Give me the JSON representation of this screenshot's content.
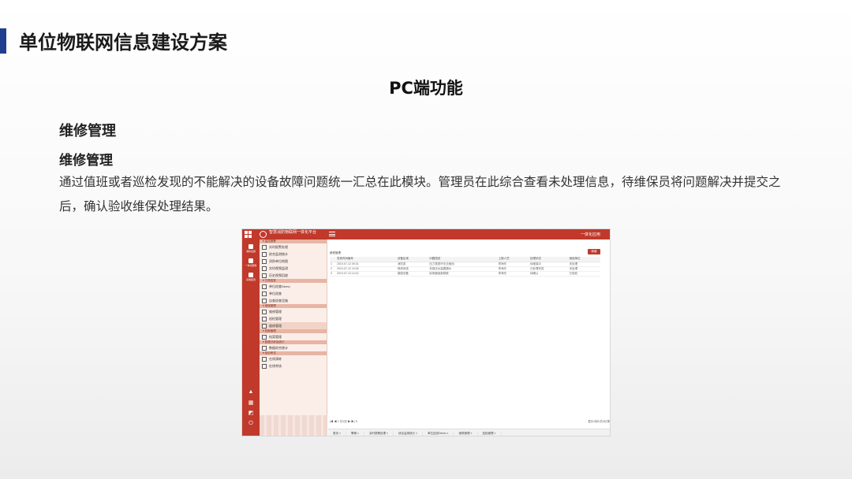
{
  "slide": {
    "title": "单位物联网信息建设方案",
    "subtitle": "PC端功能",
    "section_heading": "维修管理",
    "sub_heading": "维修管理",
    "description": "通过值班或者巡检发现的不能解决的设备故障问题统一汇总在此模块。管理员在此综合查看未处理信息，待维保员将问题解决并提交之后，确认验收维保处理结果。",
    "accent_color": "#1f3f8f"
  },
  "app": {
    "brand_color": "#c0392b",
    "name": "智慧消防物联网一体化平台",
    "top_right": "一体化应用",
    "rail": [
      {
        "label": "消防设施"
      },
      {
        "label": "一体化服务"
      },
      {
        "label": "系统配置"
      }
    ],
    "sidebar": [
      {
        "type": "group",
        "label": "监控报警"
      },
      {
        "type": "item",
        "label": "实时报警处理"
      },
      {
        "type": "item",
        "label": "综合监测统计"
      },
      {
        "type": "item",
        "label": "消防单位地图"
      },
      {
        "type": "item",
        "label": "实时视频监测"
      },
      {
        "type": "item",
        "label": "历史视频回放"
      },
      {
        "type": "group",
        "label": "日常巡查"
      },
      {
        "type": "item",
        "label": "单位巡查Demo"
      },
      {
        "type": "item",
        "label": "单位巡查"
      },
      {
        "type": "item",
        "label": "自查巡查设施"
      },
      {
        "type": "group",
        "label": "维保管理"
      },
      {
        "type": "item",
        "label": "维修管理"
      },
      {
        "type": "item",
        "label": "巡检管理"
      },
      {
        "type": "item",
        "label": "维修管理",
        "active": true
      },
      {
        "type": "group",
        "label": "档案管理"
      },
      {
        "type": "item",
        "label": "档案管理"
      },
      {
        "type": "group",
        "label": "数据分析及统计"
      },
      {
        "type": "item",
        "label": "数据综合统计"
      },
      {
        "type": "group",
        "label": "培训考试"
      },
      {
        "type": "item",
        "label": "在线演练"
      },
      {
        "type": "item",
        "label": "在线考核"
      }
    ],
    "main": {
      "breadcrumb": "维修管理",
      "add_button": "新增",
      "table": {
        "headers": [
          "",
          "发现时间编号",
          "设备区域",
          "问题描述",
          "上报人员",
          "处理状态",
          "维保单位"
        ],
        "rows": [
          [
            "1",
            "2019-07-12 09:31",
            "消防泵",
            "压力表损坏无法使用",
            "李海东",
            "待维保中",
            "未处理"
          ],
          [
            "2",
            "2019-07-12 10:05",
            "喷淋系统",
            "末端试水装置漏水",
            "李海东",
            "已处理完成",
            "未处理"
          ],
          [
            "3",
            "2019-07-13 14:22",
            "烟感设备",
            "探测器误报频繁",
            "李海东",
            "待确认",
            "已验收"
          ]
        ]
      },
      "pager_left": "|◀  ◀  1 共1页  ▶  ▶|  ↻",
      "pager_right": "显示1到3,共3记录",
      "taskbar": [
        "首页",
        "警情",
        "实时报警处理",
        "综合监测统计",
        "单位巡查Demo",
        "维修管理",
        "巡检管理"
      ]
    }
  }
}
